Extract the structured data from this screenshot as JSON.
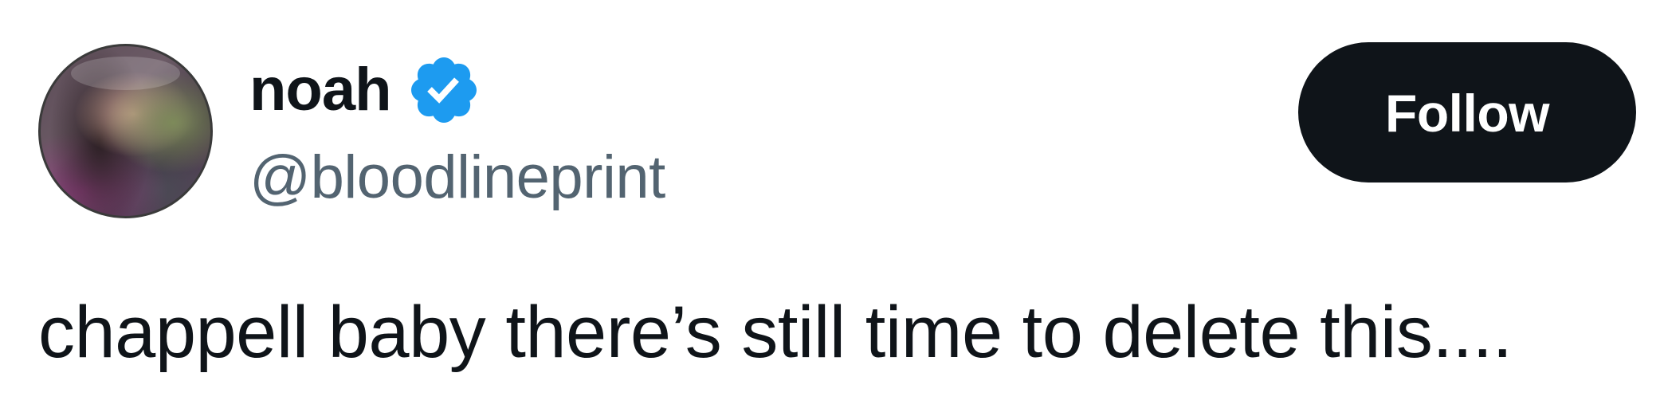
{
  "author": {
    "display_name": "noah",
    "handle": "@bloodlineprint",
    "verified": true,
    "avatar": "profile-photo"
  },
  "actions": {
    "follow_label": "Follow"
  },
  "tweet": {
    "text": "chappell baby there’s still time to delete this...."
  },
  "colors": {
    "text_primary": "#0f1419",
    "text_secondary": "#536471",
    "verified_blue": "#1d9bf0",
    "button_bg": "#0f1419",
    "button_text": "#ffffff"
  },
  "icons": {
    "verified": "verified-badge-icon"
  }
}
